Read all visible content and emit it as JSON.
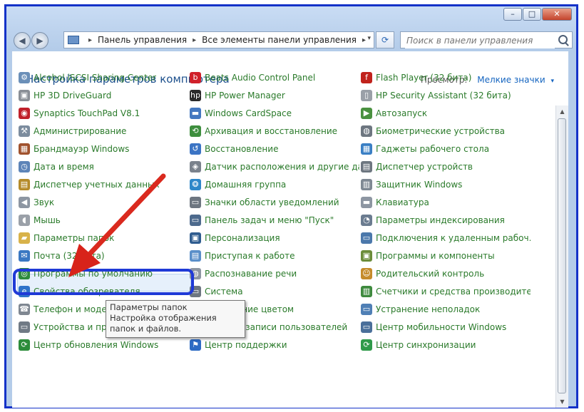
{
  "window": {
    "controls": {
      "minimize": "–",
      "maximize": "□",
      "close": "✕"
    }
  },
  "navigation": {
    "back": "◀",
    "forward": "▶",
    "breadcrumb": [
      "Панель управления",
      "Все элементы панели управления"
    ],
    "separator": "▸",
    "refresh": "⟳",
    "search_placeholder": "Поиск в панели управления"
  },
  "header": {
    "title": "Настройка параметров компьютера",
    "view_label": "Просмотр:",
    "view_value": "Мелкие значки",
    "view_arrow": "▾"
  },
  "columns": [
    [
      {
        "label": "Alcohol iSCSI Sharing Center",
        "icon": "network-share-icon",
        "color": "#6b8fb8",
        "glyph": "⚙"
      },
      {
        "label": "HP 3D DriveGuard",
        "icon": "drive-icon",
        "color": "#8a8f96",
        "glyph": "▣"
      },
      {
        "label": "Synaptics TouchPad V8.1",
        "icon": "touchpad-icon",
        "color": "#c0202a",
        "glyph": "◉"
      },
      {
        "label": "Администрирование",
        "icon": "admin-tools-icon",
        "color": "#7c8c9e",
        "glyph": "⚒"
      },
      {
        "label": "Брандмауэр Windows",
        "icon": "firewall-icon",
        "color": "#a0522d",
        "glyph": "▦"
      },
      {
        "label": "Дата и время",
        "icon": "clock-icon",
        "color": "#5d84b8",
        "glyph": "◷"
      },
      {
        "label": "Диспетчер учетных данных",
        "icon": "credentials-icon",
        "color": "#b58b2a",
        "glyph": "▤"
      },
      {
        "label": "Звук",
        "icon": "speaker-icon",
        "color": "#8d96a2",
        "glyph": "◀"
      },
      {
        "label": "Мышь",
        "icon": "mouse-icon",
        "color": "#9aa0a8",
        "glyph": "◖"
      },
      {
        "label": "Параметры папок",
        "icon": "folder-options-icon",
        "color": "#d8b24a",
        "glyph": "▰"
      },
      {
        "label": "Почта (32 бита)",
        "icon": "mail-icon",
        "color": "#3a78c2",
        "glyph": "✉"
      },
      {
        "label": "Программы по умолчанию",
        "icon": "default-programs-icon",
        "color": "#2e8b3e",
        "glyph": "◎"
      },
      {
        "label": "Свойства обозревателя",
        "icon": "internet-options-icon",
        "color": "#2f73c9",
        "glyph": "e"
      },
      {
        "label": "Телефон и модем",
        "icon": "phone-icon",
        "color": "#7f8791",
        "glyph": "☎"
      },
      {
        "label": "Устройства и принтеры",
        "icon": "printer-icon",
        "color": "#707a85",
        "glyph": "▭"
      },
      {
        "label": "Центр обновления Windows",
        "icon": "windows-update-icon",
        "color": "#2c8c3a",
        "glyph": "⟳"
      }
    ],
    [
      {
        "label": "Beats Audio Control Panel",
        "icon": "beats-audio-icon",
        "color": "#d0202a",
        "glyph": "b"
      },
      {
        "label": "HP Power Manager",
        "icon": "hp-power-icon",
        "color": "#2a2a2a",
        "glyph": "hp"
      },
      {
        "label": "Windows CardSpace",
        "icon": "cardspace-icon",
        "color": "#4478c0",
        "glyph": "▬"
      },
      {
        "label": "Архивация и восстановление",
        "icon": "backup-icon",
        "color": "#3e8e3e",
        "glyph": "⟲"
      },
      {
        "label": "Восстановление",
        "icon": "recovery-icon",
        "color": "#3b74c4",
        "glyph": "↺"
      },
      {
        "label": "Датчик расположения и другие дат…",
        "icon": "location-sensor-icon",
        "color": "#7a828c",
        "glyph": "◈"
      },
      {
        "label": "Домашняя группа",
        "icon": "homegroup-icon",
        "color": "#2e87c9",
        "glyph": "❂"
      },
      {
        "label": "Значки области уведомлений",
        "icon": "notification-icons-icon",
        "color": "#6d7680",
        "glyph": "▭"
      },
      {
        "label": "Панель задач и меню \"Пуск\"",
        "icon": "taskbar-icon",
        "color": "#4d6a8d",
        "glyph": "▭"
      },
      {
        "label": "Персонализация",
        "icon": "personalization-icon",
        "color": "#2f5c8f",
        "glyph": "▣"
      },
      {
        "label": "Приступая к работе",
        "icon": "getting-started-icon",
        "color": "#5a8fc9",
        "glyph": "▤"
      },
      {
        "label": "Распознавание речи",
        "icon": "speech-icon",
        "color": "#8d96a2",
        "glyph": "◍"
      },
      {
        "label": "Система",
        "icon": "system-icon",
        "color": "#6d7680",
        "glyph": "▭"
      },
      {
        "label": "Управление цветом",
        "icon": "color-management-icon",
        "color": "#3f6fb4",
        "glyph": "▣"
      },
      {
        "label": "Учетные записи пользователей",
        "icon": "user-accounts-icon",
        "color": "#b88a3a",
        "glyph": "☻"
      },
      {
        "label": "Центр поддержки",
        "icon": "action-center-icon",
        "color": "#2d6bc4",
        "glyph": "⚑"
      }
    ],
    [
      {
        "label": "Flash Player (32 бита)",
        "icon": "flash-player-icon",
        "color": "#c0221c",
        "glyph": "f"
      },
      {
        "label": "HP Security Assistant (32 бита)",
        "icon": "hp-security-icon",
        "color": "#9aa0a8",
        "glyph": "▯"
      },
      {
        "label": "Автозапуск",
        "icon": "autoplay-icon",
        "color": "#4a9140",
        "glyph": "▶"
      },
      {
        "label": "Биометрические устройства",
        "icon": "biometric-icon",
        "color": "#6d7680",
        "glyph": "◍"
      },
      {
        "label": "Гаджеты рабочего стола",
        "icon": "gadgets-icon",
        "color": "#3a7fc4",
        "glyph": "▦"
      },
      {
        "label": "Диспетчер устройств",
        "icon": "device-manager-icon",
        "color": "#6d7680",
        "glyph": "▤"
      },
      {
        "label": "Защитник Windows",
        "icon": "defender-icon",
        "color": "#7e8893",
        "glyph": "▥"
      },
      {
        "label": "Клавиатура",
        "icon": "keyboard-icon",
        "color": "#8d96a2",
        "glyph": "▬"
      },
      {
        "label": "Параметры индексирования",
        "icon": "indexing-icon",
        "color": "#6b7c90",
        "glyph": "◔"
      },
      {
        "label": "Подключения к удаленным рабоч…",
        "icon": "remote-desktop-icon",
        "color": "#4b78ab",
        "glyph": "▭"
      },
      {
        "label": "Программы и компоненты",
        "icon": "programs-features-icon",
        "color": "#6b8c3a",
        "glyph": "▣"
      },
      {
        "label": "Родительский контроль",
        "icon": "parental-controls-icon",
        "color": "#c58b2b",
        "glyph": "☺"
      },
      {
        "label": "Счетчики и средства производител…",
        "icon": "performance-icon",
        "color": "#3e8a3e",
        "glyph": "▥"
      },
      {
        "label": "Устранение неполадок",
        "icon": "troubleshooting-icon",
        "color": "#4f7fb5",
        "glyph": "▭"
      },
      {
        "label": "Центр мобильности Windows",
        "icon": "mobility-center-icon",
        "color": "#4a6f9a",
        "glyph": "▭"
      },
      {
        "label": "Центр синхронизации",
        "icon": "sync-center-icon",
        "color": "#2f9a4a",
        "glyph": "⟳"
      }
    ]
  ],
  "tooltip": {
    "title": "Параметры папок",
    "body": "Настройка отображения папок и файлов."
  },
  "scroll": {
    "up": "▲",
    "down": "▼"
  }
}
